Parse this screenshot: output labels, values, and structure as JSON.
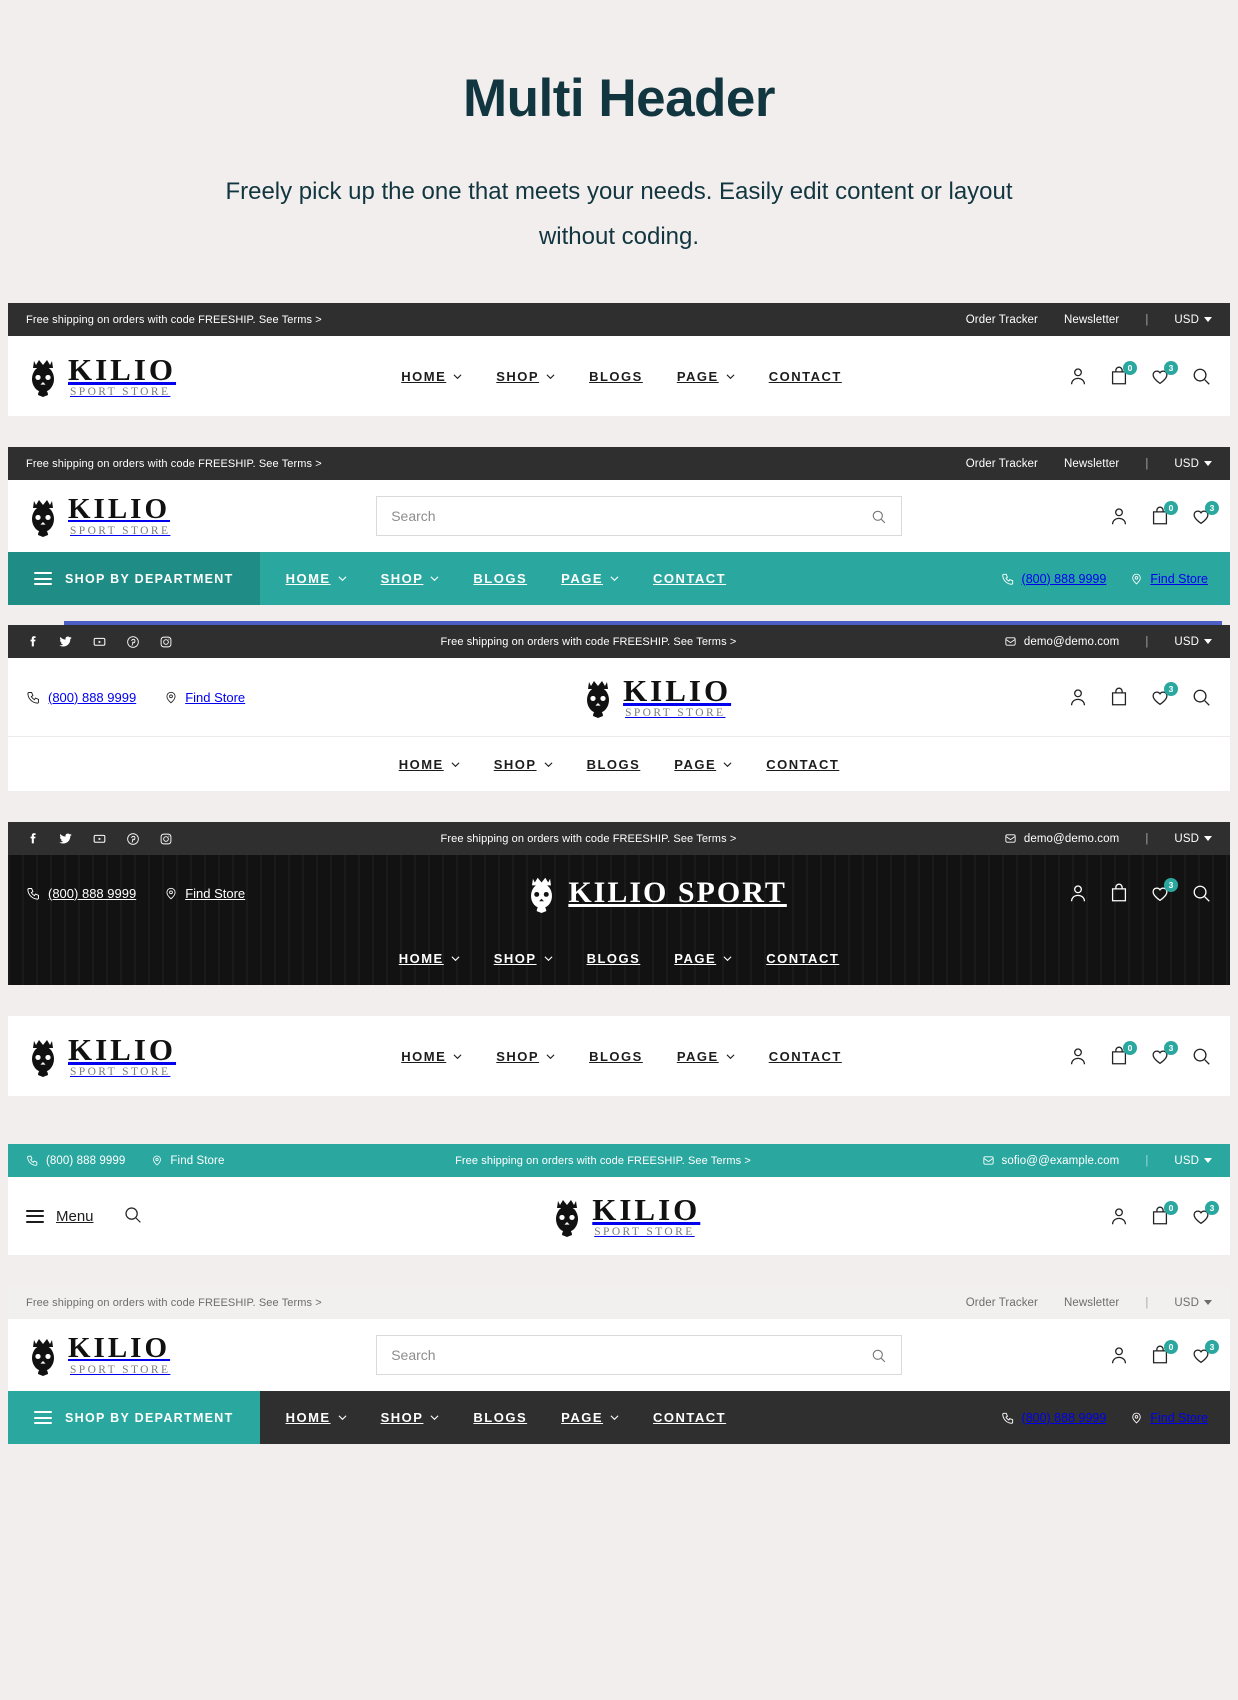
{
  "intro": {
    "title": "Multi Header",
    "subtitle": "Freely pick up the one that meets your needs. Easily edit content or layout without coding."
  },
  "brand": {
    "name": "KILIO",
    "tagline": "SPORT STORE",
    "inline_name": "KILIO SPORT"
  },
  "common": {
    "promo": "Free shipping on orders with code FREESHIP. See Terms >",
    "order_tracker": "Order Tracker",
    "newsletter": "Newsletter",
    "currency": "USD",
    "phone": "(800) 888 9999",
    "find_store": "Find Store",
    "email_demo": "demo@demo.com",
    "email_sofia": "sofio@@example.com",
    "search_placeholder": "Search",
    "dept_label": "SHOP BY DEPARTMENT",
    "menu_label": "Menu",
    "cart_count": "0",
    "wishlist_count": "3",
    "nav": [
      {
        "label": "HOME",
        "caret": true
      },
      {
        "label": "SHOP",
        "caret": true
      },
      {
        "label": "BLOGS",
        "caret": false
      },
      {
        "label": "PAGE",
        "caret": true
      },
      {
        "label": "CONTACT",
        "caret": false
      }
    ],
    "social": [
      "facebook-icon",
      "twitter-icon",
      "youtube-icon",
      "pinterest-icon",
      "instagram-icon"
    ]
  },
  "colors": {
    "accent_teal": "#2aa8a0",
    "dept_teal": "#1f8c86",
    "dark_bar": "#2f2f2f",
    "page_bg": "#f2eeed",
    "heading": "#123640"
  }
}
